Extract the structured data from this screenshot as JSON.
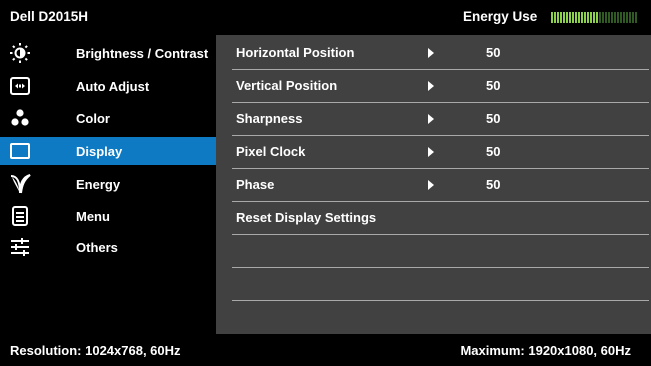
{
  "header": {
    "title": "Dell D2015H",
    "energy_label": "Energy Use",
    "energy_level": 0.55
  },
  "sidebar": {
    "items": [
      {
        "label": "Brightness / Contrast",
        "icon": "brightness-icon",
        "active": false
      },
      {
        "label": "Auto Adjust",
        "icon": "auto-adjust-icon",
        "active": false
      },
      {
        "label": "Color",
        "icon": "color-icon",
        "active": false
      },
      {
        "label": "Display",
        "icon": "display-icon",
        "active": true
      },
      {
        "label": "Energy",
        "icon": "energy-leaf-icon",
        "active": false
      },
      {
        "label": "Menu",
        "icon": "menu-icon",
        "active": false
      },
      {
        "label": "Others",
        "icon": "others-icon",
        "active": false
      }
    ]
  },
  "main": {
    "rows": [
      {
        "label": "Horizontal Position",
        "value": "50"
      },
      {
        "label": "Vertical Position",
        "value": "50"
      },
      {
        "label": "Sharpness",
        "value": "50"
      },
      {
        "label": "Pixel Clock",
        "value": "50"
      },
      {
        "label": "Phase",
        "value": "50"
      },
      {
        "label": "Reset Display Settings",
        "value": ""
      }
    ]
  },
  "footer": {
    "resolution": "Resolution: 1024x768, 60Hz",
    "maximum": "Maximum: 1920x1080, 60Hz"
  },
  "colors": {
    "accent": "#0e7ac3",
    "panel": "#414141",
    "background": "#000000",
    "meter_on": "#8cd24a",
    "meter_off": "#2f5b22"
  }
}
